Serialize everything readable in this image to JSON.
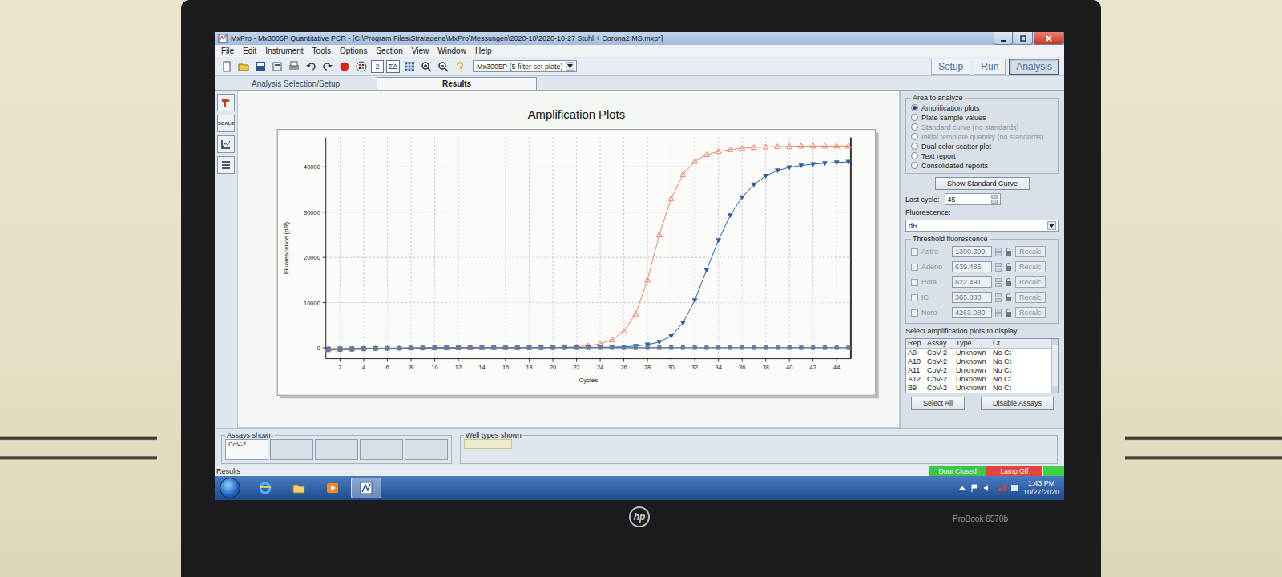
{
  "window": {
    "title": "MxPro - Mx3005P Quantitative PCR - [C:\\Program Files\\Stratagene\\MxPro\\Messungen\\2020-10\\2020-10-27 Stuhl + Corona2 MS.mxp*]"
  },
  "menu": [
    "File",
    "Edit",
    "Instrument",
    "Tools",
    "Options",
    "Section",
    "View",
    "Window",
    "Help"
  ],
  "toolbar": {
    "glyphs": [
      "2",
      "Σ∆"
    ],
    "instrument": "Mx3005P (5 filter set plate)",
    "modes": [
      {
        "label": "Setup",
        "selected": false
      },
      {
        "label": "Run",
        "selected": false
      },
      {
        "label": "Analysis",
        "selected": true
      }
    ]
  },
  "section_tabs": [
    {
      "label": "Analysis Selection/Setup",
      "selected": false
    },
    {
      "label": "Results",
      "selected": true
    }
  ],
  "tool_strip": {
    "scale_label": "SCALE"
  },
  "chart": {
    "title": "Amplification Plots",
    "y_label": "Fluorescence (dR)",
    "x_label": "Cycles",
    "y_ticks": [
      "0",
      "10000",
      "20000",
      "30000",
      "40000"
    ],
    "x_ticks": [
      "2",
      "4",
      "6",
      "8",
      "10",
      "12",
      "14",
      "16",
      "18",
      "20",
      "22",
      "24",
      "26",
      "28",
      "30",
      "32",
      "34",
      "36",
      "38",
      "40",
      "42",
      "44"
    ],
    "series": [
      {
        "kind": "triangle-up",
        "color": "#e8846a",
        "values": [
          -300,
          -250,
          -200,
          -150,
          -100,
          -80,
          -50,
          -30,
          0,
          0,
          10,
          20,
          20,
          30,
          30,
          40,
          50,
          60,
          80,
          100,
          150,
          250,
          450,
          900,
          1800,
          3700,
          7500,
          15000,
          25000,
          33000,
          38300,
          41200,
          42700,
          43400,
          43800,
          44100,
          44300,
          44400,
          44500,
          44500,
          44600,
          44600,
          44600,
          44600,
          44600
        ]
      },
      {
        "kind": "triangle-down",
        "color": "#2f5f9c",
        "values": [
          -200,
          -180,
          -150,
          -120,
          -100,
          -80,
          -60,
          -40,
          -20,
          0,
          0,
          10,
          10,
          20,
          20,
          30,
          30,
          40,
          50,
          60,
          70,
          80,
          100,
          130,
          170,
          250,
          400,
          700,
          1300,
          2600,
          5500,
          10500,
          17200,
          23800,
          29300,
          33300,
          36100,
          38000,
          39200,
          39900,
          40300,
          40600,
          40800,
          41000,
          41100
        ]
      },
      {
        "kind": "square",
        "color": "#8a6a4c",
        "values": [
          -500,
          -450,
          -400,
          -300,
          -200,
          -150,
          -100,
          -50,
          0,
          20,
          40,
          30,
          50,
          40,
          60,
          50,
          40,
          60,
          50,
          70,
          60,
          50,
          40,
          60,
          50,
          40,
          30,
          50,
          40,
          60,
          50,
          40,
          30,
          50,
          40,
          60,
          50,
          40,
          30,
          50,
          40,
          30,
          50,
          40,
          30
        ]
      },
      {
        "kind": "square",
        "color": "#5b7fa9",
        "values": [
          -350,
          -300,
          -250,
          -200,
          -150,
          -100,
          -60,
          -30,
          0,
          10,
          20,
          10,
          30,
          20,
          30,
          20,
          10,
          30,
          20,
          30,
          20,
          10,
          20,
          30,
          20,
          10,
          20,
          30,
          20,
          10,
          20,
          30,
          20,
          10,
          20,
          30,
          20,
          10,
          20,
          30,
          20,
          10,
          20,
          30,
          20
        ]
      }
    ]
  },
  "side_panel": {
    "area_to_analyze": {
      "title": "Area to analyze",
      "options": [
        {
          "label": "Amplification plots",
          "selected": true,
          "disabled": false
        },
        {
          "label": "Plate sample values",
          "selected": false,
          "disabled": false
        },
        {
          "label": "Standard curve (no standards)",
          "selected": false,
          "disabled": true
        },
        {
          "label": "Initial template quantity (no standards)",
          "selected": false,
          "disabled": true
        },
        {
          "label": "Dual color scatter plot",
          "selected": false,
          "disabled": false
        },
        {
          "label": "Text report",
          "selected": false,
          "disabled": false
        },
        {
          "label": "Consolidated reports",
          "selected": false,
          "disabled": false
        }
      ]
    },
    "show_standard_curve": "Show Standard Curve",
    "last_cycle": {
      "label": "Last cycle:",
      "value": "45"
    },
    "fluorescence": {
      "label": "Fluorescence:",
      "value": "dR"
    },
    "threshold": {
      "title": "Threshold fluorescence",
      "rows": [
        {
          "assay": "Astro",
          "value": "1300.399",
          "checked": false,
          "disabled": true,
          "button": "Recalc"
        },
        {
          "assay": "Adeno",
          "value": "639.486",
          "checked": false,
          "disabled": true,
          "button": "Recalc"
        },
        {
          "assay": "Rota",
          "value": "622.491",
          "checked": false,
          "disabled": true,
          "button": "Recalc"
        },
        {
          "assay": "IC",
          "value": "365.888",
          "checked": false,
          "disabled": true,
          "button": "Recalc"
        },
        {
          "assay": "Noro",
          "value": "4263.080",
          "checked": false,
          "disabled": true,
          "button": "Recalc"
        }
      ]
    },
    "plots_table": {
      "title": "Select amplification plots to display",
      "columns": [
        "Rep",
        "Assay",
        "Type",
        "Ct"
      ],
      "rows": [
        [
          "A9",
          "CoV-2",
          "Unknown",
          "No Ct"
        ],
        [
          "A10",
          "CoV-2",
          "Unknown",
          "No Ct"
        ],
        [
          "A11",
          "CoV-2",
          "Unknown",
          "No Ct"
        ],
        [
          "A12",
          "CoV-2",
          "Unknown",
          "No Ct"
        ],
        [
          "B9",
          "CoV-2",
          "Unknown",
          "No Ct"
        ]
      ]
    },
    "buttons": [
      "Select All",
      "Disable Assays"
    ]
  },
  "assays_shown": {
    "title": "Assays shown",
    "tabs": [
      "CoV-2"
    ]
  },
  "well_types_shown": {
    "title": "Well types shown"
  },
  "status_bar": {
    "text": "Results",
    "indicators": [
      {
        "label": "Door Closed",
        "color": "#3bc64a"
      },
      {
        "label": "Lamp Off",
        "color": "#e0453e"
      }
    ]
  },
  "taskbar": {
    "pinned": [
      {
        "selected": false
      },
      {
        "selected": false
      },
      {
        "selected": false
      },
      {
        "selected": true
      }
    ],
    "time": "1:43 PM",
    "date": "10/27/2020"
  },
  "laptop": {
    "brand": "hp",
    "model": "ProBook 6570b"
  }
}
